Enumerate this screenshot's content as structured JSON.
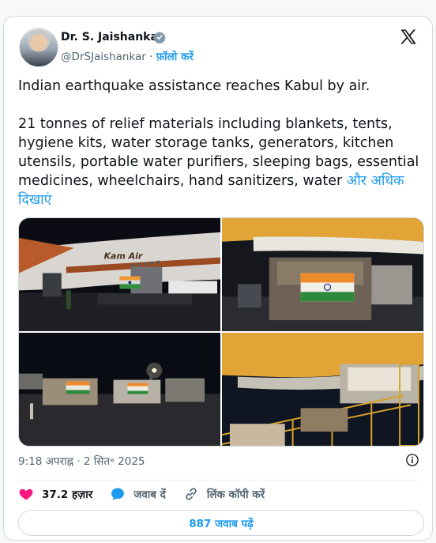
{
  "author": {
    "name": "Dr. S. Jaishankar",
    "handle": "@DrSJaishankar",
    "separator": "·",
    "follow_label": "फ़ॉलो करें"
  },
  "tweet": {
    "line1": "Indian earthquake assistance reaches Kabul by air.",
    "body_lines": [
      "21 tonnes of relief materials including blankets, tents,",
      "hygiene kits, water storage tanks, generators, kitchen",
      "utensils, portable water purifiers, sleeping bags, essential",
      "medicines, wheelchairs, hand sanitizers, water"
    ],
    "show_more_1": "और अधिक",
    "show_more_2": "दिखाएं"
  },
  "photos": [
    {
      "name": "photo-plane-kam-air",
      "plane_text": "Kam Air"
    },
    {
      "name": "photo-cargo-hold-flag"
    },
    {
      "name": "photo-trucks-night"
    },
    {
      "name": "photo-loading-platform"
    }
  ],
  "meta": {
    "time": "9:18 अपराह्न",
    "dot": "·",
    "date": "2 सित॰ 2025"
  },
  "actions": {
    "likes": "37.2 हज़ार",
    "reply": "जवाब दें",
    "copy_link": "लिंक कॉपी करें"
  },
  "replies_button": "887 जवाब पढ़ें",
  "colors": {
    "accent": "#1d9bf0",
    "like": "#f91880",
    "secondary_text": "#536471"
  },
  "icons": [
    "verified-badge-icon",
    "x-logo-icon",
    "info-icon",
    "heart-icon",
    "reply-bubble-icon",
    "link-icon"
  ]
}
